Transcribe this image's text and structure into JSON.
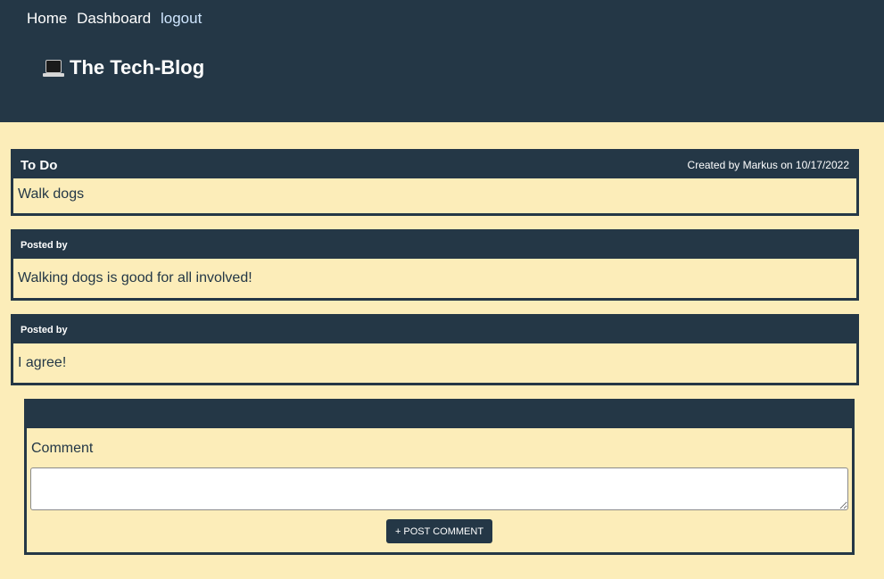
{
  "nav": {
    "home": "Home",
    "dashboard": "Dashboard",
    "logout": "logout"
  },
  "brand": {
    "icon": "laptop-icon",
    "title": "The Tech-Blog"
  },
  "post": {
    "title": "To Do",
    "meta": "Created by Markus on 10/17/2022",
    "content": "Walk dogs"
  },
  "comments": [
    {
      "meta": "Posted by",
      "text": "Walking dogs is good for all involved!"
    },
    {
      "meta": "Posted by",
      "text": "I agree!"
    }
  ],
  "comment_form": {
    "header": "",
    "label": "Comment",
    "value": "",
    "button_label": "+ POST COMMENT"
  },
  "colors": {
    "primary": "#243746",
    "background": "#fcedb9",
    "link": "#cfe6ff"
  }
}
